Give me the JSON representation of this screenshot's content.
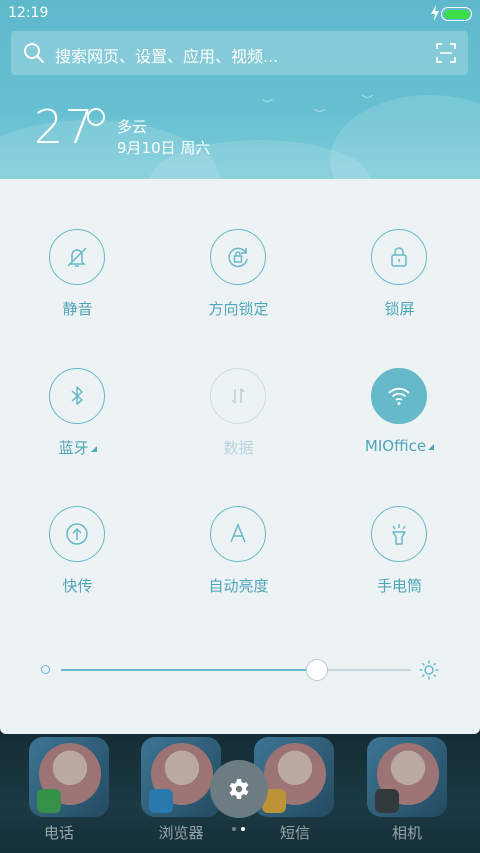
{
  "status_bar": {
    "time": "12:19",
    "battery_color": "#3ddc4a"
  },
  "search": {
    "placeholder": "搜索网页、设置、应用、视频...",
    "icon": "search-icon",
    "scan_icon": "scan-icon"
  },
  "weather": {
    "temperature": "27",
    "condition": "多云",
    "date": "9月10日 周六"
  },
  "toggles": [
    {
      "label": "静音",
      "icon": "bell-off-icon",
      "state": "off"
    },
    {
      "label": "方向锁定",
      "icon": "rotation-lock-icon",
      "state": "off"
    },
    {
      "label": "锁屏",
      "icon": "lock-icon",
      "state": "off"
    },
    {
      "label": "蓝牙",
      "icon": "bluetooth-icon",
      "state": "off",
      "has_menu": true
    },
    {
      "label": "数据",
      "icon": "mobile-data-icon",
      "state": "disabled"
    },
    {
      "label": "MIOffice",
      "icon": "wifi-icon",
      "state": "on",
      "has_menu": true
    },
    {
      "label": "快传",
      "icon": "transfer-icon",
      "state": "off"
    },
    {
      "label": "自动亮度",
      "icon": "auto-brightness-icon",
      "state": "off"
    },
    {
      "label": "手电筒",
      "icon": "flashlight-icon",
      "state": "off"
    }
  ],
  "brightness": {
    "level": 0.73
  },
  "dock": [
    {
      "label": "电话",
      "badge_color": "#3fae4b"
    },
    {
      "label": "浏览器",
      "badge_color": "#2f8fd0"
    },
    {
      "label": "短信",
      "badge_color": "#f2b233"
    },
    {
      "label": "相机",
      "badge_color": "#3a3a3a"
    }
  ],
  "page_indicator": {
    "count": 2,
    "active": 1
  },
  "colors": {
    "accent": "#66b9c9",
    "panel": "#edf2f4",
    "header": "#66c0d1"
  }
}
